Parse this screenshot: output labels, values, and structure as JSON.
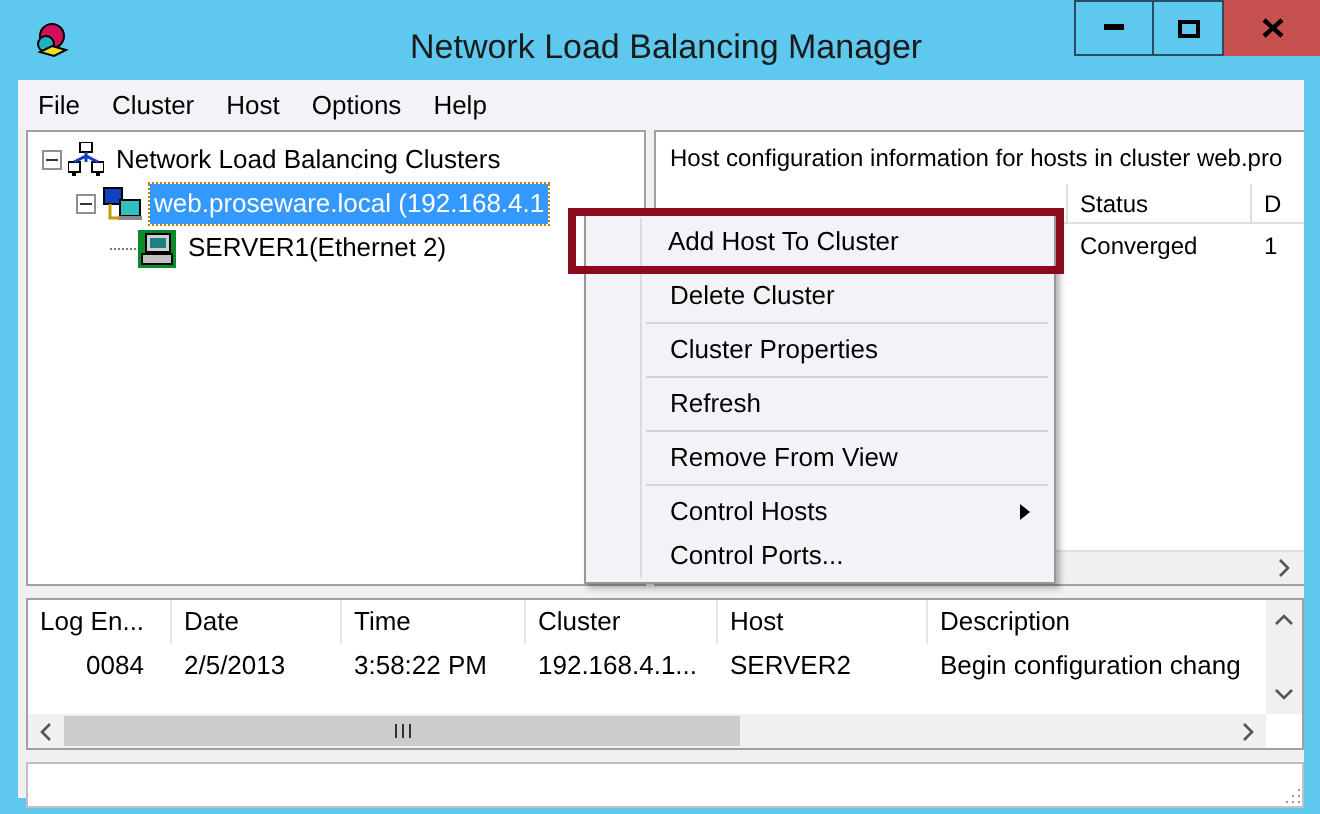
{
  "window": {
    "title": "Network Load Balancing Manager"
  },
  "menu_bar": [
    "File",
    "Cluster",
    "Host",
    "Options",
    "Help"
  ],
  "tree": [
    {
      "label": "Network Load Balancing Clusters",
      "kind": "root",
      "expanded": true,
      "selected": false,
      "children": [
        {
          "label": "web.proseware.local (192.168.4.1",
          "kind": "cluster",
          "expanded": true,
          "selected": true,
          "children": [
            {
              "label": "SERVER1(Ethernet 2)",
              "kind": "host",
              "selected": false
            }
          ]
        }
      ]
    }
  ],
  "host_panel": {
    "heading": "Host configuration information for hosts in cluster web.pro",
    "columns": [
      "Status",
      "D"
    ],
    "rows": [
      [
        "Converged",
        "1"
      ]
    ]
  },
  "context_menu": {
    "items": [
      {
        "label": "Add Host To Cluster",
        "highlighted": true,
        "submenu": false,
        "separator_before": false
      },
      {
        "label": "Delete Cluster",
        "highlighted": false,
        "submenu": false,
        "separator_before": false
      },
      {
        "label": "Cluster Properties",
        "highlighted": false,
        "submenu": false,
        "separator_before": true
      },
      {
        "label": "Refresh",
        "highlighted": false,
        "submenu": false,
        "separator_before": true
      },
      {
        "label": "Remove From View",
        "highlighted": false,
        "submenu": false,
        "separator_before": true
      },
      {
        "label": "Control Hosts",
        "highlighted": false,
        "submenu": true,
        "separator_before": true
      },
      {
        "label": "Control Ports...",
        "highlighted": false,
        "submenu": false,
        "separator_before": false
      }
    ]
  },
  "log": {
    "columns": [
      "Log En...",
      "Date",
      "Time",
      "Cluster",
      "Host",
      "Description"
    ],
    "rows": [
      [
        "0084",
        "2/5/2013",
        "3:58:22 PM",
        "192.168.4.1...",
        "SERVER2",
        "Begin configuration chang"
      ]
    ]
  }
}
